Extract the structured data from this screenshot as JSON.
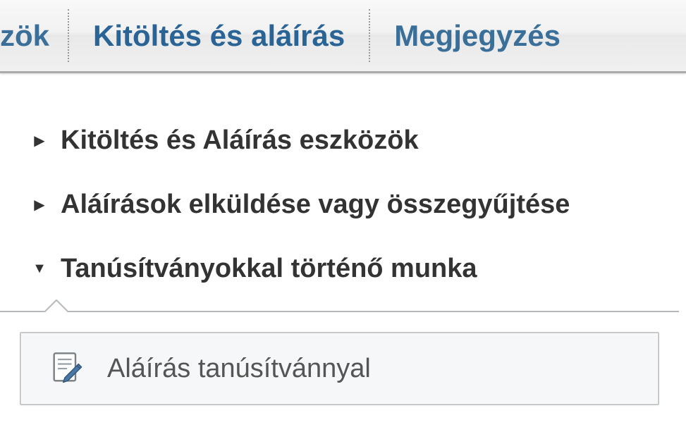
{
  "toolbar": {
    "tabs": [
      {
        "label": "zök"
      },
      {
        "label": "Kitöltés és aláírás"
      },
      {
        "label": "Megjegyzés"
      }
    ]
  },
  "panel": {
    "items": [
      {
        "label": "Kitöltés és Aláírás eszközök",
        "expanded": false
      },
      {
        "label": "Aláírások elküldése vagy összegyűjtése",
        "expanded": false
      },
      {
        "label": "Tanúsítványokkal történő munka",
        "expanded": true
      }
    ],
    "action": {
      "label": "Aláírás tanúsítvánnyal",
      "icon": "sign-document-icon"
    }
  },
  "glyphs": {
    "collapsed": "▶",
    "expanded": "▼"
  }
}
